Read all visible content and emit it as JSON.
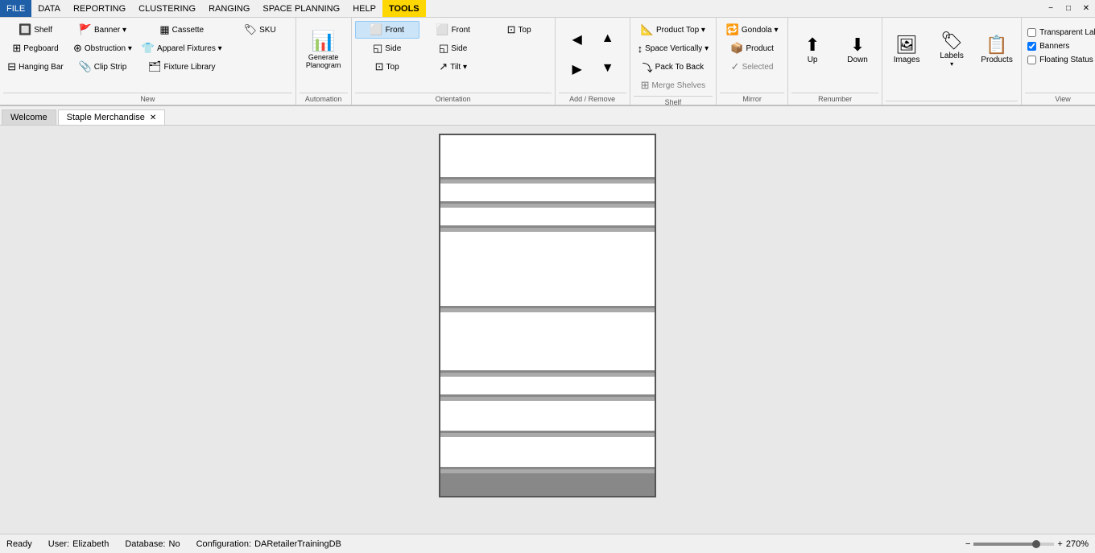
{
  "menu": {
    "items": [
      {
        "id": "file",
        "label": "FILE",
        "state": "active"
      },
      {
        "id": "data",
        "label": "DATA",
        "state": "normal"
      },
      {
        "id": "reporting",
        "label": "REPORTING",
        "state": "normal"
      },
      {
        "id": "clustering",
        "label": "CLUSTERING",
        "state": "normal"
      },
      {
        "id": "ranging",
        "label": "RANGING",
        "state": "normal"
      },
      {
        "id": "space-planning",
        "label": "SPACE PLANNING",
        "state": "normal"
      },
      {
        "id": "help",
        "label": "HELP",
        "state": "normal"
      },
      {
        "id": "tools",
        "label": "TOOLS",
        "state": "highlighted"
      }
    ],
    "window_controls": [
      "−",
      "□",
      "✕"
    ]
  },
  "ribbon": {
    "groups": [
      {
        "id": "new",
        "label": "New",
        "items": [
          {
            "id": "shelf",
            "label": "Shelf",
            "icon": "📦",
            "type": "small"
          },
          {
            "id": "pegboard",
            "label": "Pegboard",
            "icon": "⊞",
            "type": "small"
          },
          {
            "id": "hanging-bar",
            "label": "Hanging Bar",
            "icon": "⊟",
            "type": "small"
          },
          {
            "id": "banner",
            "label": "Banner ▾",
            "icon": "🚩",
            "type": "small"
          },
          {
            "id": "obstruction",
            "label": "Obstruction ▾",
            "icon": "⚠",
            "type": "small"
          },
          {
            "id": "clip-strip",
            "label": "Clip Strip",
            "icon": "📎",
            "type": "small"
          },
          {
            "id": "cassette",
            "label": "Cassette",
            "icon": "▦",
            "type": "small"
          },
          {
            "id": "apparel-fixtures",
            "label": "Apparel Fixtures ▾",
            "icon": "👕",
            "type": "small"
          },
          {
            "id": "fixture-library",
            "label": "Fixture Library",
            "icon": "🗂",
            "type": "small"
          },
          {
            "id": "sku",
            "label": "SKU",
            "icon": "🏷",
            "type": "small"
          }
        ]
      },
      {
        "id": "automation",
        "label": "Automation",
        "items": [
          {
            "id": "generate-planogram",
            "label": "Generate\nPlanogram",
            "icon": "📊",
            "type": "large"
          }
        ]
      },
      {
        "id": "orientation",
        "label": "Orientation",
        "items": [
          {
            "id": "front",
            "label": "Front",
            "icon": "▢",
            "type": "small",
            "active": true
          },
          {
            "id": "side-orient",
            "label": "Side",
            "icon": "▢",
            "type": "small"
          },
          {
            "id": "top-orient",
            "label": "Top",
            "icon": "▢",
            "type": "small"
          },
          {
            "id": "front2",
            "label": "Front",
            "icon": "▢",
            "type": "small"
          },
          {
            "id": "side2",
            "label": "Side",
            "icon": "▢",
            "type": "small"
          },
          {
            "id": "tilt",
            "label": "Tilt ▾",
            "icon": "↗",
            "type": "small"
          },
          {
            "id": "top2",
            "label": "Top",
            "icon": "▢",
            "type": "small"
          }
        ]
      },
      {
        "id": "add-remove",
        "label": "Add / Remove",
        "items": [
          {
            "id": "add-left",
            "label": "",
            "icon": "◀",
            "type": "icon-only"
          },
          {
            "id": "add-right",
            "label": "",
            "icon": "▶",
            "type": "icon-only"
          },
          {
            "id": "add-up",
            "label": "",
            "icon": "▲",
            "type": "icon-only"
          },
          {
            "id": "add-down",
            "label": "",
            "icon": "▼",
            "type": "icon-only"
          }
        ]
      },
      {
        "id": "shelf",
        "label": "Shelf",
        "items": [
          {
            "id": "product-top",
            "label": "Product Top ▾",
            "icon": "📐",
            "type": "small"
          },
          {
            "id": "space-vertically",
            "label": "Space Vertically ▾",
            "icon": "↕",
            "type": "small"
          },
          {
            "id": "pack-to-back",
            "label": "Pack To Back",
            "icon": "⤵",
            "type": "small"
          },
          {
            "id": "merge-shelves",
            "label": "Merge Shelves",
            "icon": "⊞",
            "type": "small",
            "disabled": true
          }
        ]
      },
      {
        "id": "mirror",
        "label": "Mirror",
        "items": [
          {
            "id": "gondola",
            "label": "Gondola ▾",
            "icon": "🔁",
            "type": "small"
          },
          {
            "id": "product",
            "label": "Product",
            "icon": "📦",
            "type": "small"
          },
          {
            "id": "selected",
            "label": "Selected",
            "icon": "✓",
            "type": "small",
            "disabled": true
          }
        ]
      },
      {
        "id": "renumber",
        "label": "Renumber",
        "items": [
          {
            "id": "up",
            "label": "Up",
            "icon": "⬆",
            "type": "large"
          },
          {
            "id": "down",
            "label": "Down",
            "icon": "⬇",
            "type": "large"
          }
        ]
      },
      {
        "id": "images-labels",
        "label": "",
        "items": [
          {
            "id": "images",
            "label": "Images",
            "icon": "🖼",
            "type": "large"
          },
          {
            "id": "labels",
            "label": "Labels",
            "icon": "🏷",
            "type": "large"
          },
          {
            "id": "products",
            "label": "Products",
            "icon": "📋",
            "type": "large"
          }
        ]
      },
      {
        "id": "view",
        "label": "View",
        "checkboxes": [
          {
            "id": "transparent-lab",
            "label": "Transparent Lab",
            "checked": false
          },
          {
            "id": "banners",
            "label": "Banners",
            "checked": true
          },
          {
            "id": "floating-status",
            "label": "Floating Status",
            "checked": false
          }
        ]
      }
    ]
  },
  "tabs": [
    {
      "id": "welcome",
      "label": "Welcome",
      "closable": false,
      "active": false
    },
    {
      "id": "staple-merchandise",
      "label": "Staple Merchandise",
      "closable": true,
      "active": true
    }
  ],
  "status_bar": {
    "ready": "Ready",
    "user_label": "User:",
    "user": "Elizabeth",
    "database_label": "Database:",
    "database": "No",
    "configuration_label": "Configuration:",
    "configuration": "DARetailerTrainingDB",
    "zoom_minus": "−",
    "zoom_plus": "+",
    "zoom_value": "270%"
  },
  "colors": {
    "active_tab_bg": "#ffffff",
    "inactive_tab_bg": "#d8d8d8",
    "ribbon_bg": "#f5f5f5",
    "active_menu": "#1e5fa8",
    "highlight_menu": "#ffd700"
  }
}
